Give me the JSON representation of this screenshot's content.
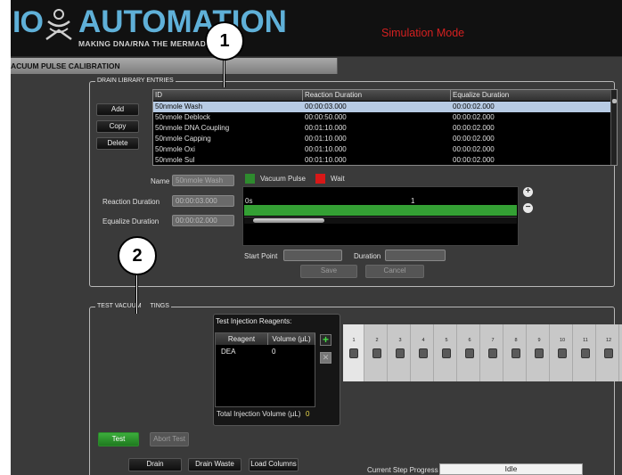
{
  "header": {
    "logo_prefix": "IO",
    "logo_main": "AUTOMATION",
    "tagline": "MAKING DNA/RNA THE MERMADE WAY",
    "mode": "Simulation Mode"
  },
  "page_title": "ACUUM PULSE CALIBRATION",
  "drain_library": {
    "legend": "DRAIN LIBRARY ENTRIES",
    "buttons": {
      "add": "Add",
      "copy": "Copy",
      "delete": "Delete"
    },
    "columns": [
      "ID",
      "Reaction Duration",
      "Equalize Duration"
    ],
    "rows": [
      {
        "id": "50nmole Wash",
        "reaction": "00:00:03.000",
        "equalize": "00:00:02.000",
        "selected": true
      },
      {
        "id": "50nmole Deblock",
        "reaction": "00:00:50.000",
        "equalize": "00:00:02.000"
      },
      {
        "id": "50nmole DNA Coupling",
        "reaction": "00:01:10.000",
        "equalize": "00:00:02.000"
      },
      {
        "id": "50nmole Capping",
        "reaction": "00:01:10.000",
        "equalize": "00:00:02.000"
      },
      {
        "id": "50nmole Oxi",
        "reaction": "00:01:10.000",
        "equalize": "00:00:02.000"
      },
      {
        "id": "50nmole Sul",
        "reaction": "00:01:10.000",
        "equalize": "00:00:02.000"
      }
    ]
  },
  "editor": {
    "name_label": "Name",
    "name_value": "50nmole Wash",
    "reaction_label": "Reaction Duration",
    "reaction_value": "00:00:03.000",
    "equalize_label": "Equalize Duration",
    "equalize_value": "00:00:02.000",
    "legend_vacuum": "Vacuum Pulse",
    "legend_wait": "Wait",
    "vacuum_color": "#2e8b2e",
    "wait_color": "#d81818",
    "timeline_start": "0s",
    "timeline_marker": "1",
    "start_point_label": "Start Point",
    "duration_label": "Duration",
    "save": "Save",
    "cancel": "Cancel",
    "zoom_in_icon": "zoom-in-icon",
    "zoom_out_icon": "zoom-out-icon"
  },
  "test_settings": {
    "legend_left": "TEST VACUUM",
    "legend_right": "TINGS",
    "reagents_title": "Test Injection Reagents:",
    "reagent_columns": [
      "Reagent",
      "Volume (µL)"
    ],
    "reagent_rows": [
      {
        "reagent": "DEA",
        "volume": "0"
      }
    ],
    "total_label": "Total Injection Volume (µL)",
    "total_value": "0",
    "columns": [
      "1",
      "2",
      "3",
      "4",
      "5",
      "6",
      "7",
      "8",
      "9",
      "10",
      "11",
      "12"
    ],
    "test": "Test",
    "abort": "Abort Test",
    "drain": "Drain",
    "drain_waste": "Drain Waste",
    "load_columns": "Load Columns",
    "progress_label": "Current Step Progress",
    "progress_value": "Idle"
  },
  "callouts": [
    "1",
    "2"
  ]
}
